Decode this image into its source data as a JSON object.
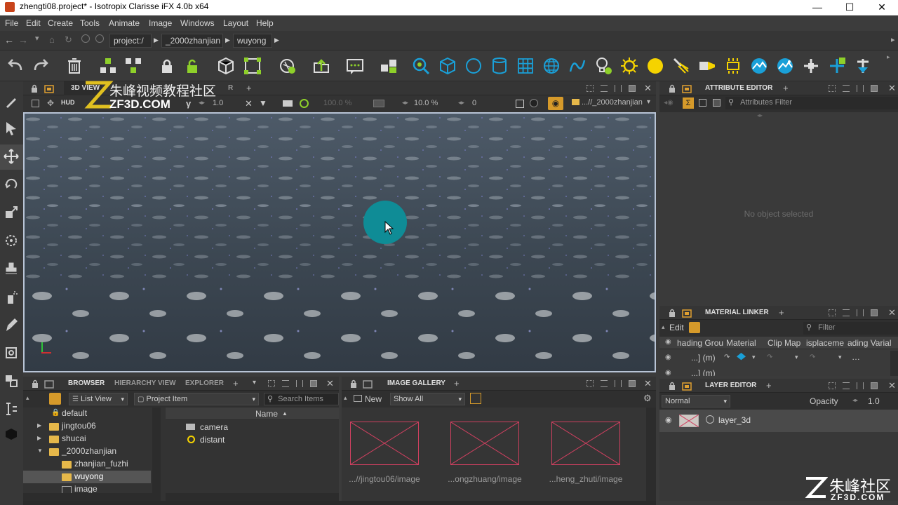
{
  "window": {
    "title": "zhengti08.project* - Isotropix Clarisse iFX 4.0b x64",
    "minimize": "—",
    "maximize": "☐",
    "close": "✕"
  },
  "menu": [
    "File",
    "Edit",
    "Create",
    "Tools",
    "Animate",
    "Image",
    "Windows",
    "Layout",
    "Help"
  ],
  "path": {
    "segments": [
      "project:/",
      "_2000zhanjian",
      "wuyong"
    ]
  },
  "watermark": {
    "cn": "朱峰视频教程社区",
    "url": "ZF3D.COM",
    "corner_cn": "朱峰社区",
    "corner_url": "ZF3D.COM"
  },
  "viewport": {
    "tabs": [
      "3D VIEW",
      "R"
    ],
    "hud": "HUD",
    "gamma": "1.0",
    "percent1": "100.0 %",
    "percent2": "10.0 %",
    "frame": "0",
    "context": "...//_2000zhanjian"
  },
  "attribute_editor": {
    "title": "ATTRIBUTE EDITOR",
    "filter_placeholder": "Attributes Filter",
    "empty": "No object selected"
  },
  "material_linker": {
    "title": "MATERIAL LINKER",
    "edit": "Edit",
    "filter_placeholder": "Filter",
    "columns": [
      "hading Grou",
      "Material",
      "Clip Map",
      "isplaceme",
      "ading Varial"
    ],
    "row1": "...] (m)",
    "row2": "...] (m)"
  },
  "layer_editor": {
    "title": "LAYER EDITOR",
    "blend": "Normal",
    "opacity_label": "Opacity",
    "opacity": "1.0",
    "layers": [
      "layer_3d"
    ]
  },
  "browser": {
    "tabs": [
      "BROWSER",
      "HIERARCHY VIEW",
      "EXPLORER"
    ],
    "view_mode": "List View",
    "filter": "Project Item",
    "search_placeholder": "Search Items",
    "tree": [
      "default",
      "jingtou06",
      "shucai",
      "_2000zhanjian",
      "zhanjian_fuzhi",
      "wuyong",
      "image"
    ],
    "column": "Name",
    "items": [
      "camera",
      "distant"
    ]
  },
  "gallery": {
    "title": "IMAGE GALLERY",
    "new": "New",
    "show": "Show All",
    "images": [
      "...//jingtou06/image",
      "...ongzhuang/image",
      "...heng_zhuti/image"
    ]
  },
  "colors": {
    "accent": "#1aa0d8",
    "highlight": "#f5d300",
    "selection": "#5a5a5a"
  }
}
